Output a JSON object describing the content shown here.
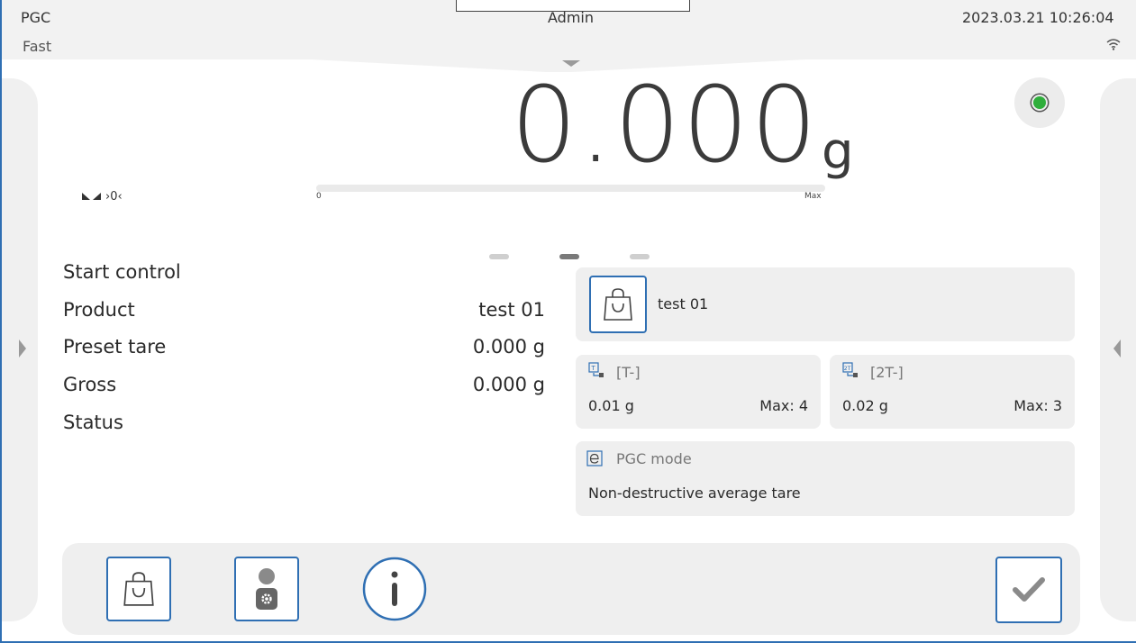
{
  "header": {
    "app_name": "PGC",
    "mode": "Fast",
    "user": "Admin",
    "datetime": "2023.03.21 10:26:04",
    "wifi_icon": "wifi-icon"
  },
  "display": {
    "weight": "0.000",
    "unit": "g",
    "zero_indicator": "›0‹",
    "bar_min": "0",
    "bar_max": "Max",
    "bar_fill_fraction": 0,
    "status_color": "#2fae3c"
  },
  "pages": {
    "count": 3,
    "active_index": 1
  },
  "info": {
    "rows": [
      {
        "label": "Start control",
        "value": ""
      },
      {
        "label": "Product",
        "value": "test 01"
      },
      {
        "label": "Preset tare",
        "value": "0.000 g"
      },
      {
        "label": "Gross",
        "value": "0.000 g"
      },
      {
        "label": "Status",
        "value": ""
      }
    ]
  },
  "widgets": {
    "product": {
      "name": "test 01",
      "icon": "shopping-bag-icon"
    },
    "t_minus": {
      "title": "[T-]",
      "value": "0.01 g",
      "max": "Max: 4",
      "icon": "tare-t-icon"
    },
    "t2_minus": {
      "title": "[2T-]",
      "value": "0.02 g",
      "max": "Max: 3",
      "icon": "tare-2t-icon"
    },
    "pgc_mode": {
      "title": "PGC mode",
      "value": "Non-destructive average tare",
      "icon": "e-mode-icon"
    }
  },
  "toolbar": {
    "buttons": [
      {
        "icon": "shopping-bag-icon"
      },
      {
        "icon": "user-settings-icon"
      },
      {
        "icon": "info-icon"
      },
      {
        "icon": "checkmark-icon"
      }
    ]
  },
  "colors": {
    "accent": "#2f6fb3",
    "panel": "#efefef",
    "status_ok": "#2fae3c"
  }
}
